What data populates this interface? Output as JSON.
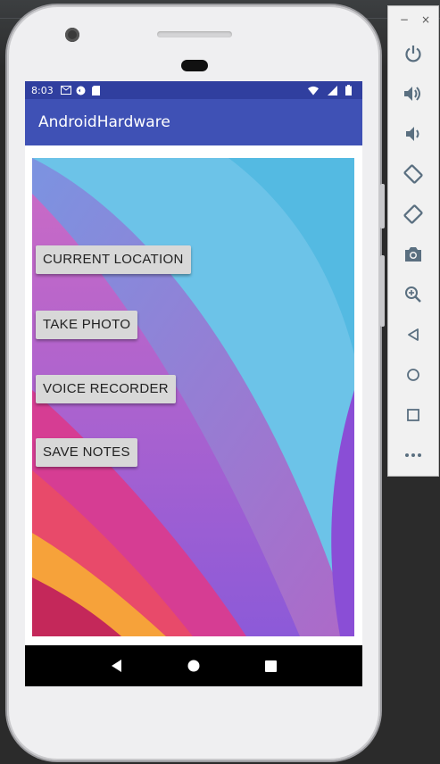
{
  "status_bar": {
    "time": "8:03",
    "left_icons": [
      "gmail-icon",
      "sync-icon",
      "sd-card-icon",
      "square-icon"
    ],
    "right_icons": [
      "wifi-icon",
      "signal-icon",
      "battery-icon"
    ]
  },
  "app_bar": {
    "title": "AndroidHardware"
  },
  "buttons": {
    "current_location": "CURRENT LOCATION",
    "take_photo": "TAKE PHOTO",
    "voice_recorder": "VOICE RECORDER",
    "save_notes": "SAVE NOTES"
  },
  "nav_bar": {
    "icons": [
      "back-icon",
      "home-icon",
      "recents-icon"
    ]
  },
  "emulator_toolbar": {
    "window_controls": {
      "minimize": "−",
      "close": "×"
    },
    "items": [
      "power-icon",
      "volume-up-icon",
      "volume-down-icon",
      "rotate-left-icon",
      "rotate-right-icon",
      "camera-icon",
      "zoom-icon",
      "back-icon",
      "home-icon",
      "overview-icon",
      "more-icon"
    ]
  },
  "colors": {
    "status_bar": "#303f9f",
    "app_bar": "#3f51b5",
    "button_bg": "#d8d8d8",
    "toolbar_icon": "#5a6f80"
  }
}
